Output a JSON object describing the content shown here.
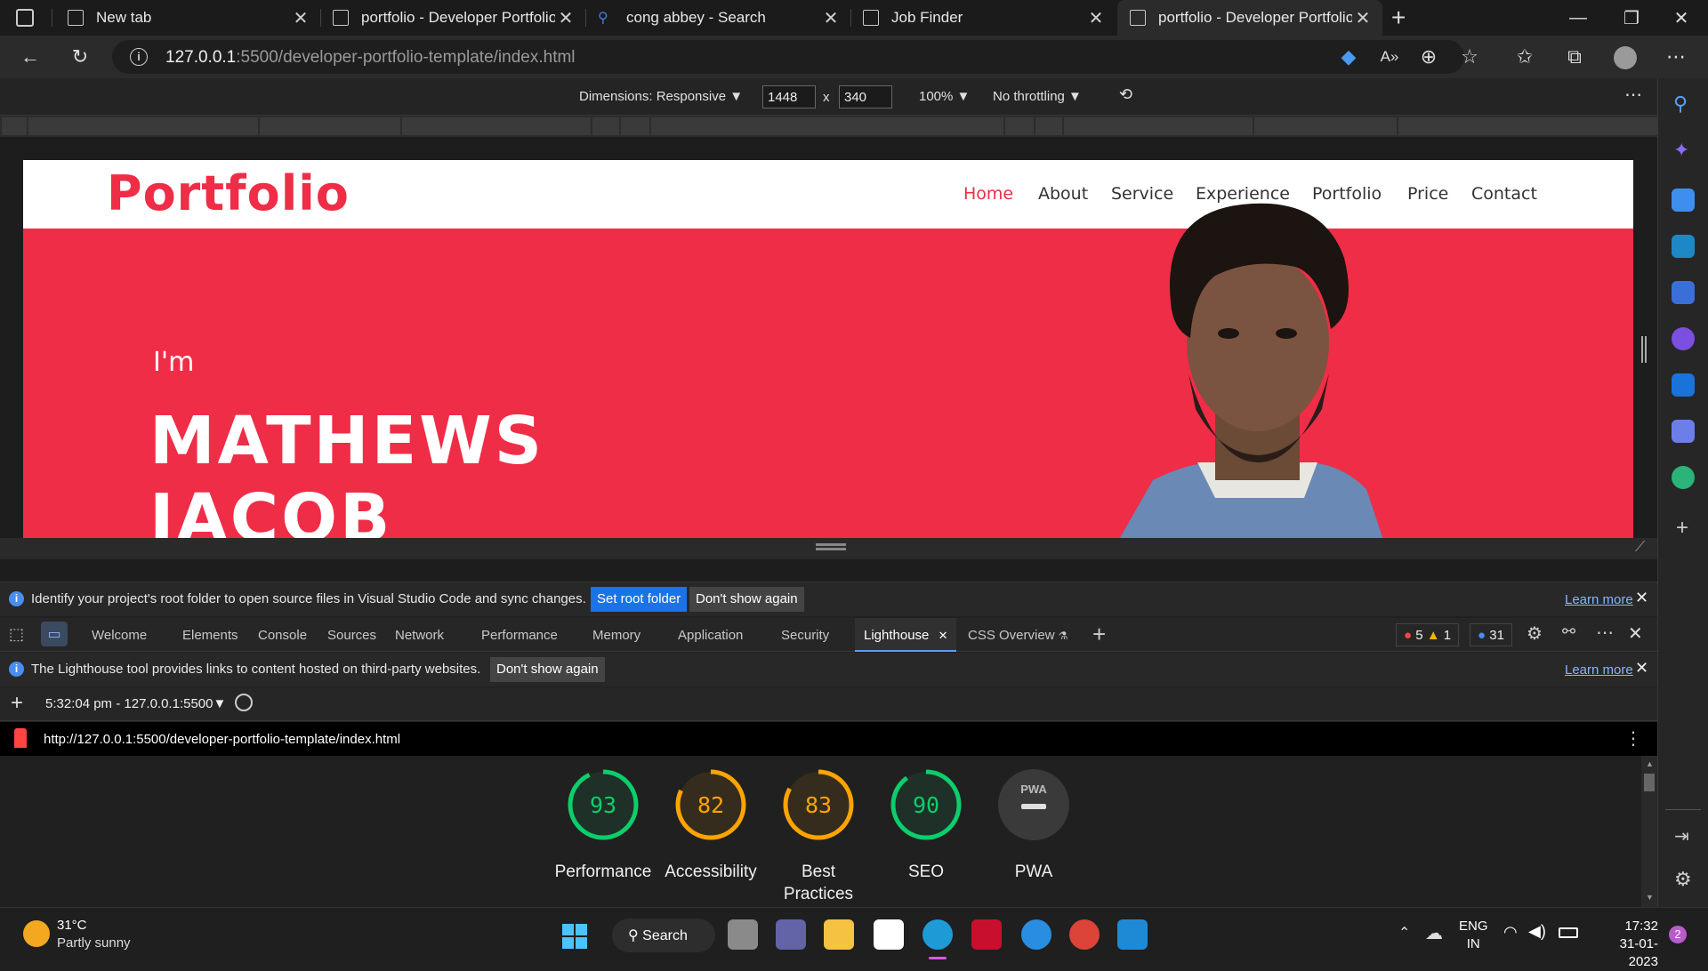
{
  "browser": {
    "tabs": [
      {
        "title": "New tab"
      },
      {
        "title": "portfolio - Developer Portfolio Te"
      },
      {
        "title": "cong abbey - Search"
      },
      {
        "title": "Job Finder"
      },
      {
        "title": "portfolio - Developer Portfolio Te"
      }
    ],
    "url_host": "127.0.0.1",
    "url_rest": ":5500/developer-portfolio-template/index.html"
  },
  "device_toolbar": {
    "dimensions_label": "Dimensions: Responsive",
    "width": "1448",
    "height": "340",
    "times": "x",
    "zoom": "100%",
    "throttling": "No throttling"
  },
  "site": {
    "logo": "Portfolio",
    "nav": [
      "Home",
      "About",
      "Service",
      "Experience",
      "Portfolio",
      "Price",
      "Contact"
    ],
    "hero_intro": "I'm",
    "hero_first": "MATHEWS",
    "hero_last": "JACOB",
    "colors": {
      "brand": "#ef2d47"
    }
  },
  "devtools": {
    "root_notice": {
      "message": "Identify your project's root folder to open source files in Visual Studio Code and sync changes.",
      "set_root": "Set root folder",
      "dont_show": "Don't show again",
      "learn_more": "Learn more"
    },
    "tabs": [
      "Welcome",
      "Elements",
      "Console",
      "Sources",
      "Network",
      "Performance",
      "Memory",
      "Application",
      "Security",
      "Lighthouse",
      "CSS Overview"
    ],
    "counts": {
      "errors": "5",
      "warnings": "1",
      "info": "31"
    },
    "lh_notice": {
      "message": "The Lighthouse tool provides links to content hosted on third-party websites.",
      "dont_show": "Don't show again",
      "learn_more": "Learn more"
    },
    "report_selector": "5:32:04 pm - 127.0.0.1:5500",
    "report_url": "http://127.0.0.1:5500/developer-portfolio-template/index.html",
    "scores": [
      {
        "label": "Performance",
        "score": "93",
        "color": "#0cce6b"
      },
      {
        "label": "Accessibility",
        "score": "82",
        "color": "#ffa400"
      },
      {
        "label": "Best Practices",
        "score": "83",
        "color": "#ffa400"
      },
      {
        "label": "SEO",
        "score": "90",
        "color": "#0cce6b"
      },
      {
        "label": "PWA",
        "score": "PWA",
        "color": "#9e9e9e"
      }
    ]
  },
  "taskbar": {
    "weather_temp": "31°C",
    "weather_desc": "Partly sunny",
    "search": "Search",
    "lang1": "ENG",
    "lang2": "IN",
    "time": "17:32",
    "date": "31-01-2023",
    "notif_count": "2"
  }
}
